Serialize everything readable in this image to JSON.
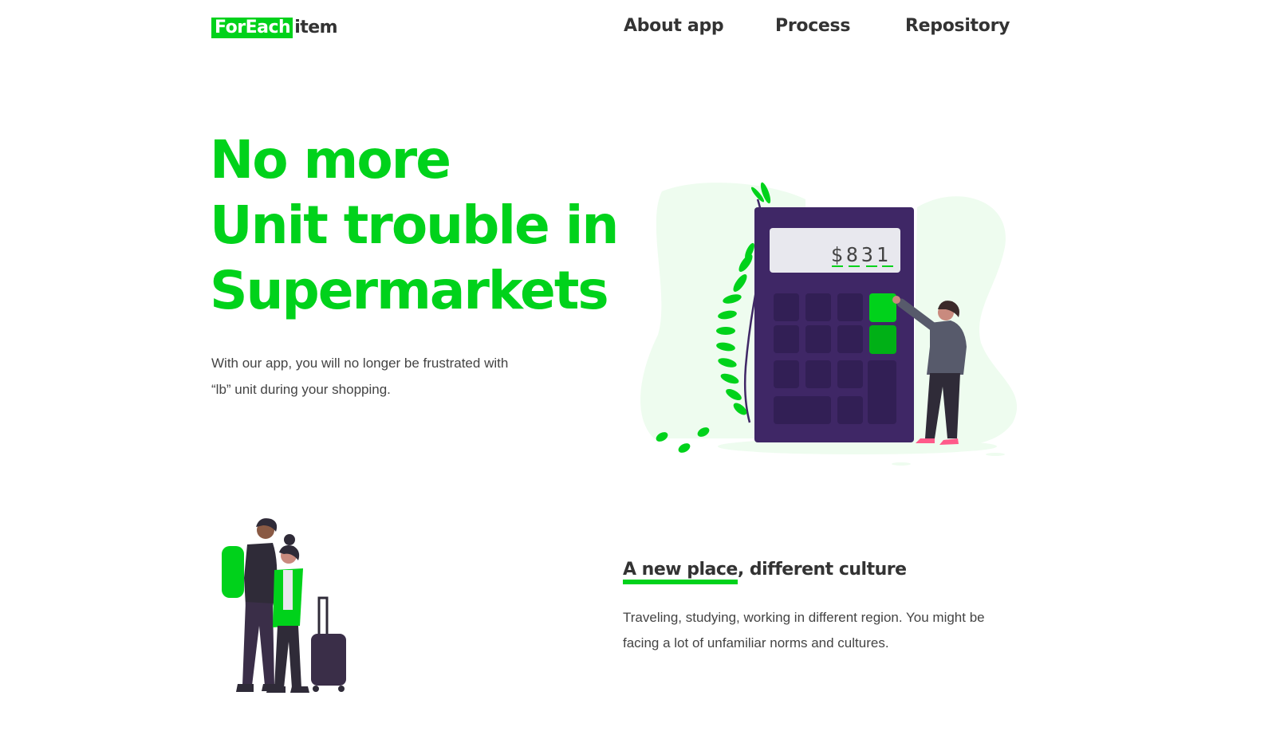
{
  "header": {
    "logo_mark": "ForEach",
    "logo_text": "item",
    "nav": [
      {
        "label": "About app"
      },
      {
        "label": "Process"
      },
      {
        "label": "Repository"
      }
    ]
  },
  "hero": {
    "title_lines": [
      "No more",
      "Unit trouble in",
      "Supermarkets"
    ],
    "text_lines": [
      "With our app, you will no longer be frustrated with",
      "“lb” unit during your shopping."
    ],
    "display_value": "$831"
  },
  "section": {
    "title_highlight": "A new place",
    "title_rest": ", different culture",
    "text_lines": [
      "Traveling, studying, working in different region. You might be",
      "facing a lot of unfamiliar norms and cultures."
    ]
  },
  "colors": {
    "brand_green": "#00d21b",
    "dark_text": "#333333",
    "calculator_purple": "#3f2766",
    "blob_green": "#eefcef"
  }
}
